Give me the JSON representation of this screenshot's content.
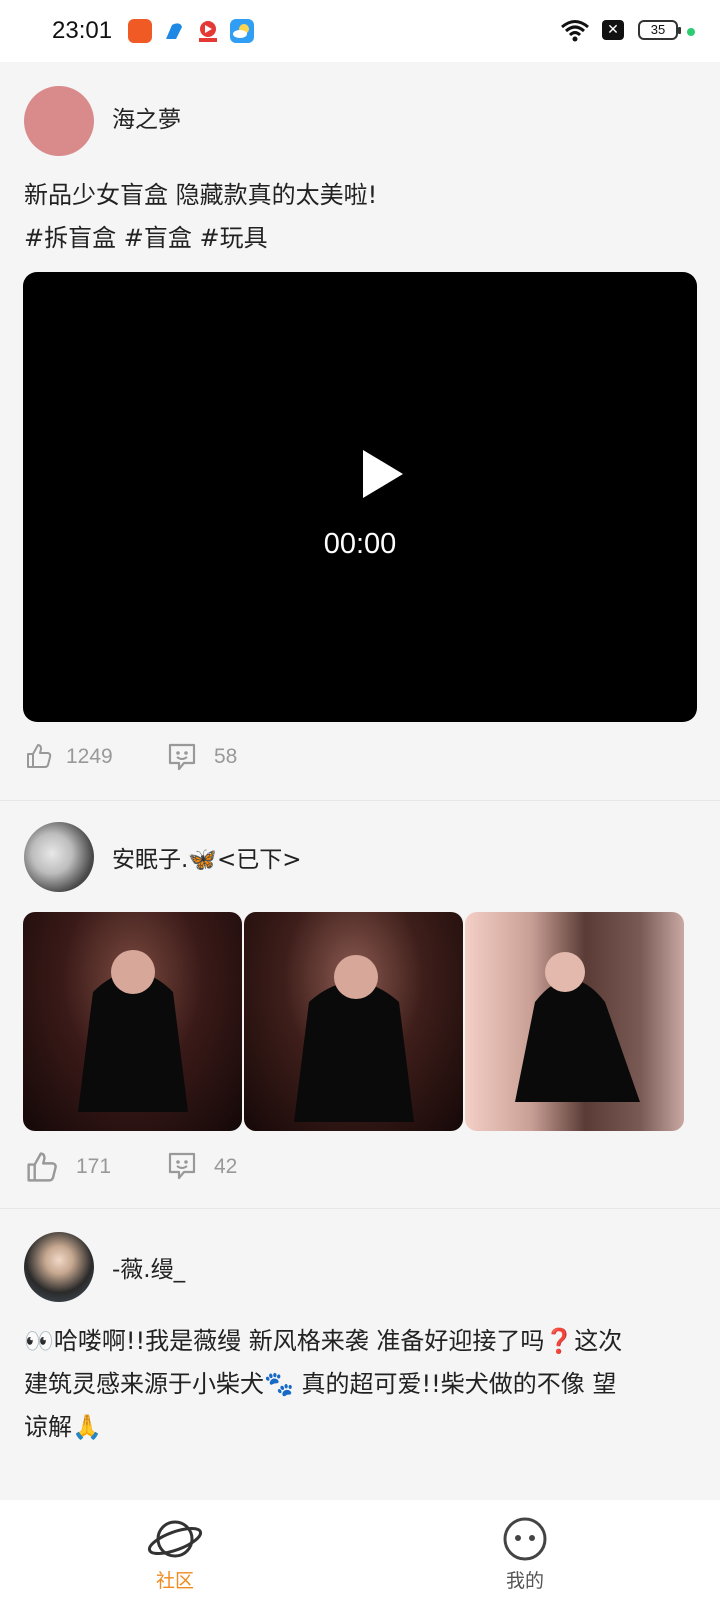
{
  "status_bar": {
    "time": "23:01",
    "battery": "35",
    "icons": [
      "app-icon-orange",
      "app-icon-blue",
      "app-icon-video",
      "app-icon-weather",
      "wifi-icon",
      "close-box-icon",
      "battery-icon"
    ]
  },
  "posts": [
    {
      "user": "海之夢",
      "text_line1": "新品少女盲盒 隐藏款真的太美啦!",
      "text_line2": "#拆盲盒 #盲盒 #玩具",
      "video_time": "00:00",
      "likes": "1249",
      "comments": "58"
    },
    {
      "user": "安眠子.🦋<已下>",
      "likes": "171",
      "comments": "42"
    },
    {
      "user": "-薇.缦_",
      "text_line1": "👀哈喽啊!!我是薇缦 新风格来袭 准备好迎接了吗❓这次",
      "text_line2": "建筑灵感来源于小柴犬🐾 真的超可爱!!柴犬做的不像 望",
      "text_line3": "谅解🙏"
    }
  ],
  "nav": {
    "community_label": "社区",
    "mine_label": "我的",
    "active_color": "#f08a1c",
    "inactive_color": "#555555"
  }
}
